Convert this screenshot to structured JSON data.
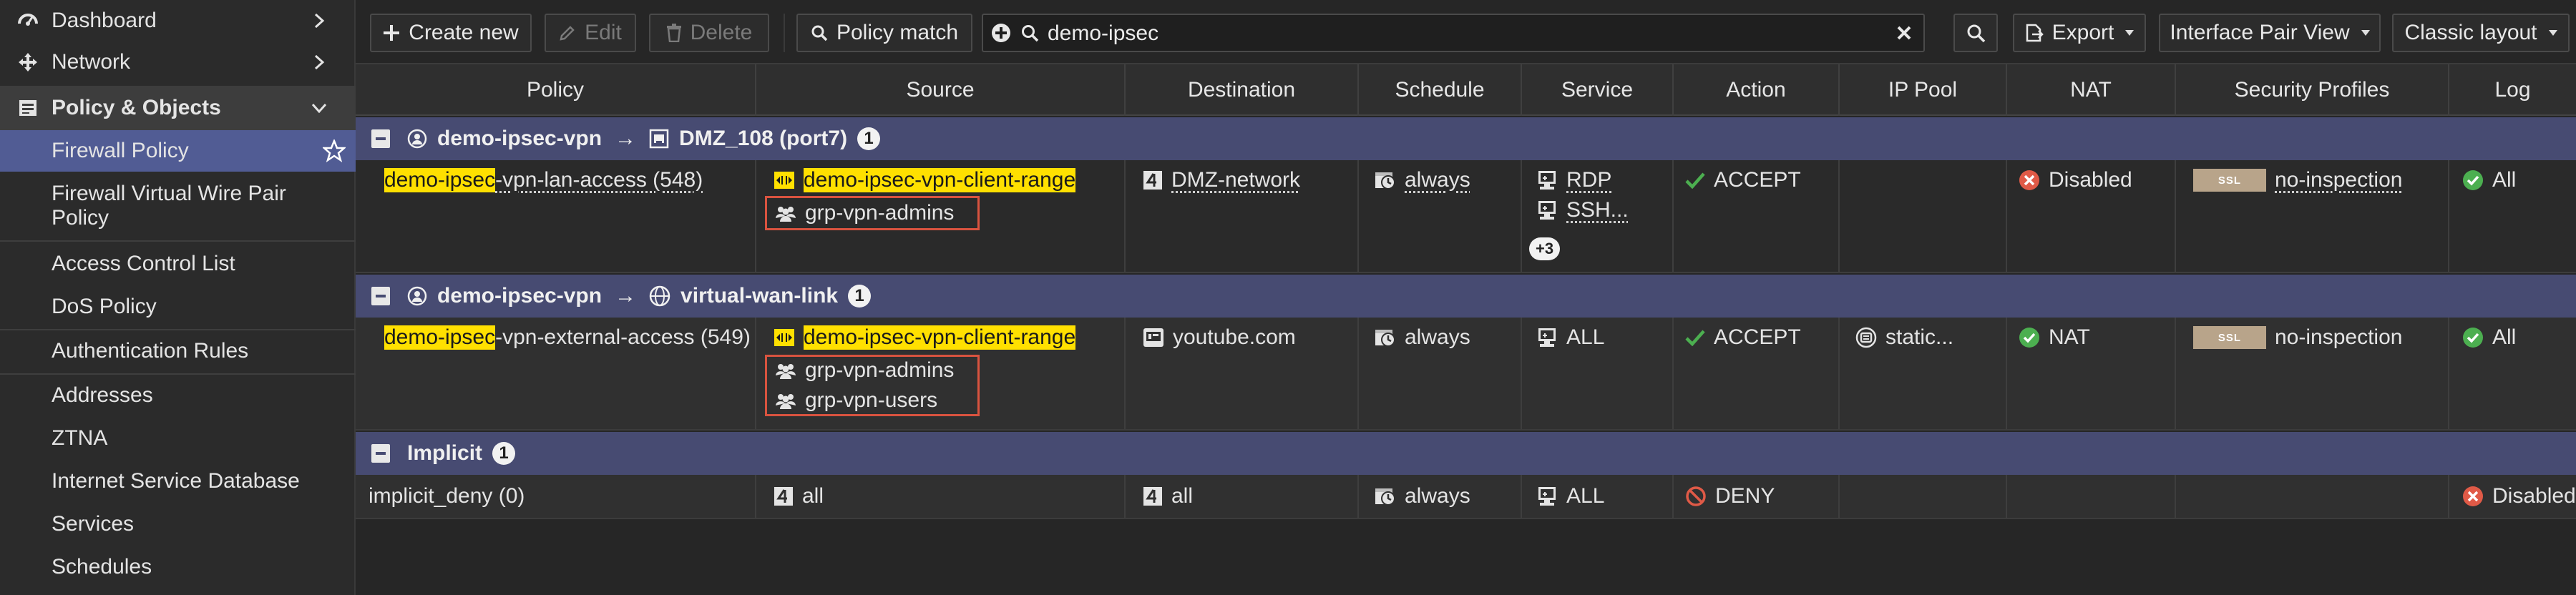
{
  "sidebar": {
    "top_items": [
      {
        "label": "Dashboard",
        "icon": "dashboard-icon"
      },
      {
        "label": "Network",
        "icon": "network-icon"
      },
      {
        "label": "Policy & Objects",
        "icon": "policy-objects-icon"
      }
    ],
    "sub_items": [
      "Firewall Policy",
      "Firewall Virtual Wire Pair Policy",
      "Access Control List",
      "DoS Policy",
      "Authentication Rules",
      "Addresses",
      "ZTNA",
      "Internet Service Database",
      "Services",
      "Schedules"
    ],
    "active_item": "Firewall Policy"
  },
  "toolbar": {
    "create_new": "Create new",
    "edit": "Edit",
    "delete": "Delete",
    "policy_match": "Policy match",
    "search_value": "demo-ipsec",
    "export": "Export",
    "view": "Interface Pair View",
    "layout": "Classic layout"
  },
  "columns": [
    "Policy",
    "Source",
    "Destination",
    "Schedule",
    "Service",
    "Action",
    "IP Pool",
    "NAT",
    "Security Profiles",
    "Log"
  ],
  "groups": [
    {
      "from": "demo-ipsec-vpn",
      "arrow": "→",
      "to": "DMZ_108 (port7)",
      "count": "1",
      "policy": {
        "name_highlight": "demo-ipsec",
        "name_rest": "-vpn-lan-access (548)",
        "source_address": "demo-ipsec-vpn-client-range",
        "source_groups": [
          "grp-vpn-admins"
        ],
        "destination": "DMZ-network",
        "schedule": "always",
        "services": [
          "RDP",
          "SSH..."
        ],
        "services_more": "+3",
        "action": "ACCEPT",
        "ip_pool": "",
        "nat": "Disabled",
        "security_profile": "no-inspection",
        "ssl_label": "SSL",
        "log": "All"
      }
    },
    {
      "from": "demo-ipsec-vpn",
      "arrow": "→",
      "to": "virtual-wan-link",
      "count": "1",
      "policy": {
        "name_highlight": "demo-ipsec",
        "name_rest": "-vpn-external-access (549)",
        "source_address": "demo-ipsec-vpn-client-range",
        "source_groups": [
          "grp-vpn-admins",
          "grp-vpn-users"
        ],
        "destination": "youtube.com",
        "schedule": "always",
        "services": [
          "ALL"
        ],
        "action": "ACCEPT",
        "ip_pool": "static...",
        "nat": "NAT",
        "security_profile": "no-inspection",
        "ssl_label": "SSL",
        "log": "All"
      }
    }
  ],
  "implicit": {
    "label": "Implicit",
    "count": "1",
    "policy": {
      "name": "implicit_deny (0)",
      "source": "all",
      "destination": "all",
      "schedule": "always",
      "service": "ALL",
      "action": "DENY",
      "log": "Disabled"
    }
  },
  "colors": {
    "accent": "#515c94",
    "group_header": "#474b72",
    "highlight": "#ffe000",
    "accept": "#4caf50",
    "deny": "#e05a47",
    "box": "#d9533f"
  }
}
